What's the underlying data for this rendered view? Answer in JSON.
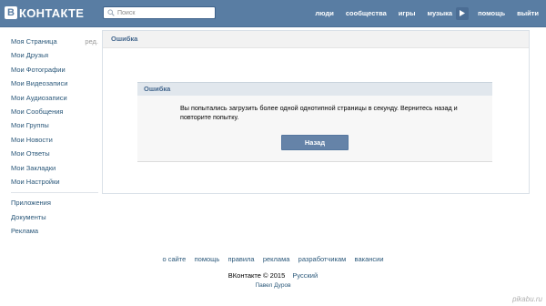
{
  "header": {
    "logo_letter": "В",
    "logo_text": "КОНТАКТЕ",
    "search_placeholder": "Поиск",
    "nav": [
      "люди",
      "сообщества",
      "игры",
      "музыка",
      "помощь",
      "выйти"
    ],
    "brand_color": "#597da3"
  },
  "sidebar": {
    "edit_label": "ред.",
    "items": [
      "Моя Страница",
      "Мои Друзья",
      "Мои Фотографии",
      "Мои Видеозаписи",
      "Мои Аудиозаписи",
      "Мои Сообщения",
      "Мои Группы",
      "Мои Новости",
      "Мои Ответы",
      "Мои Закладки",
      "Мои Настройки"
    ],
    "extra": [
      "Приложения",
      "Документы",
      "Реклама"
    ]
  },
  "content": {
    "title": "Ошибка",
    "error": {
      "title": "Ошибка",
      "message": "Вы попытались загрузить более одной однотипной страницы в секунду. Вернитесь назад и повторите попытку.",
      "button": "Назад"
    }
  },
  "footer": {
    "links": [
      "о сайте",
      "помощь",
      "правила",
      "реклама",
      "разработчикам",
      "вакансии"
    ],
    "copyright": "ВКонтакте © 2015",
    "language": "Русский",
    "author": "Павел Дуров"
  },
  "watermark": "pikabu.ru"
}
